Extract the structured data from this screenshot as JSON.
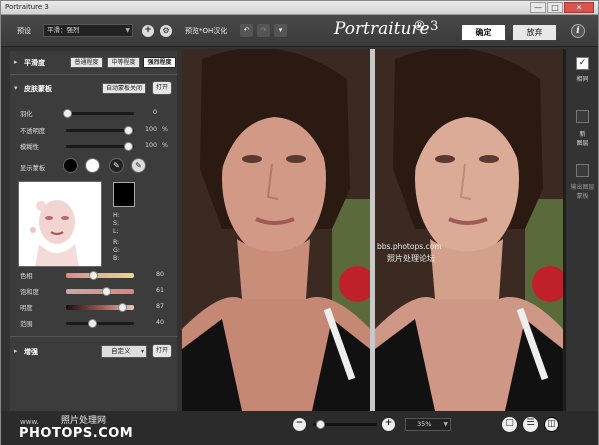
{
  "window": {
    "title": "Portraiture 3",
    "minimize": "—",
    "maximize": "□",
    "close": "✕"
  },
  "toolbar": {
    "preset_label": "预设",
    "preset_value": "平滑：强烈",
    "preview_label": "预览*OH汉化",
    "brand": "Portraiture",
    "brand_suffix": "® 3",
    "ok": "确定",
    "cancel": "放弃",
    "help": "i"
  },
  "panel": {
    "smoothing": {
      "title": "平滑度",
      "btn_normal": "普通程度",
      "btn_medium": "中等程度",
      "btn_strong": "强烈程度"
    },
    "skin": {
      "title": "皮肤蒙板",
      "auto_mask": "自动蒙板关闭",
      "open": "打开",
      "sliders": [
        {
          "label": "羽化",
          "value": "0",
          "pct": ""
        },
        {
          "label": "不透明度",
          "value": "100",
          "pct": "%"
        },
        {
          "label": "模糊性",
          "value": "100",
          "pct": "%"
        }
      ],
      "show_mask": "显示蒙板",
      "readouts": {
        "h": "H:",
        "s": "S:",
        "l": "L:",
        "r": "R:",
        "g": "G:",
        "b": "B:"
      },
      "color_sliders": [
        {
          "label": "色相",
          "value": "80"
        },
        {
          "label": "饱和度",
          "value": "61"
        },
        {
          "label": "明度",
          "value": "87"
        },
        {
          "label": "范围",
          "value": "40"
        }
      ]
    },
    "enhance": {
      "title": "增强",
      "custom": "自定义",
      "open": "打开"
    }
  },
  "image": {
    "watermark_site": "bbs.photops.com",
    "watermark_text": "照片处理论坛"
  },
  "rightbar": {
    "tile_label": "相同",
    "new_label": "新",
    "new_label2": "图层",
    "output_label": "输出图层",
    "output_label2": "蒙板"
  },
  "bottom": {
    "zoom": "35%",
    "logo_line1": "照片处理网",
    "logo_www": "www.",
    "logo_main": "PHOTOPS.COM"
  }
}
